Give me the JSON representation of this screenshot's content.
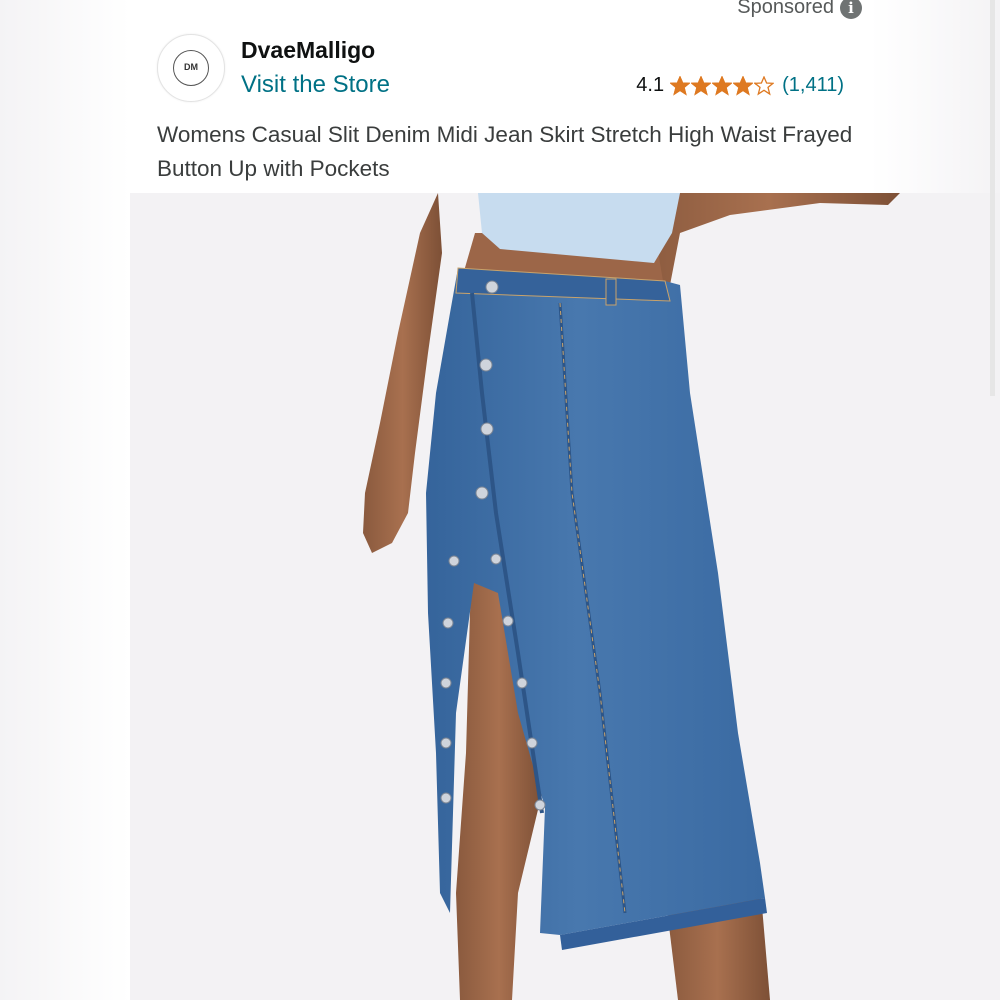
{
  "sponsored": {
    "label": "Sponsored",
    "info_icon": "info-icon"
  },
  "seller": {
    "logo_text": "DM",
    "name": "DvaeMalligo",
    "store_link": "Visit the Store"
  },
  "rating": {
    "value": "4.1",
    "stars_filled": 4.1,
    "stars_max": 5,
    "review_count": "(1,411)",
    "star_color": "#de7921"
  },
  "product": {
    "title": "Womens Casual Slit Denim Midi Jean Skirt Stretch High Waist Frayed Button Up with Pockets",
    "image": "denim-midi-skirt-photo"
  },
  "colors": {
    "link": "#007185",
    "text": "#0f1111",
    "denim": "#3f6ea6"
  }
}
